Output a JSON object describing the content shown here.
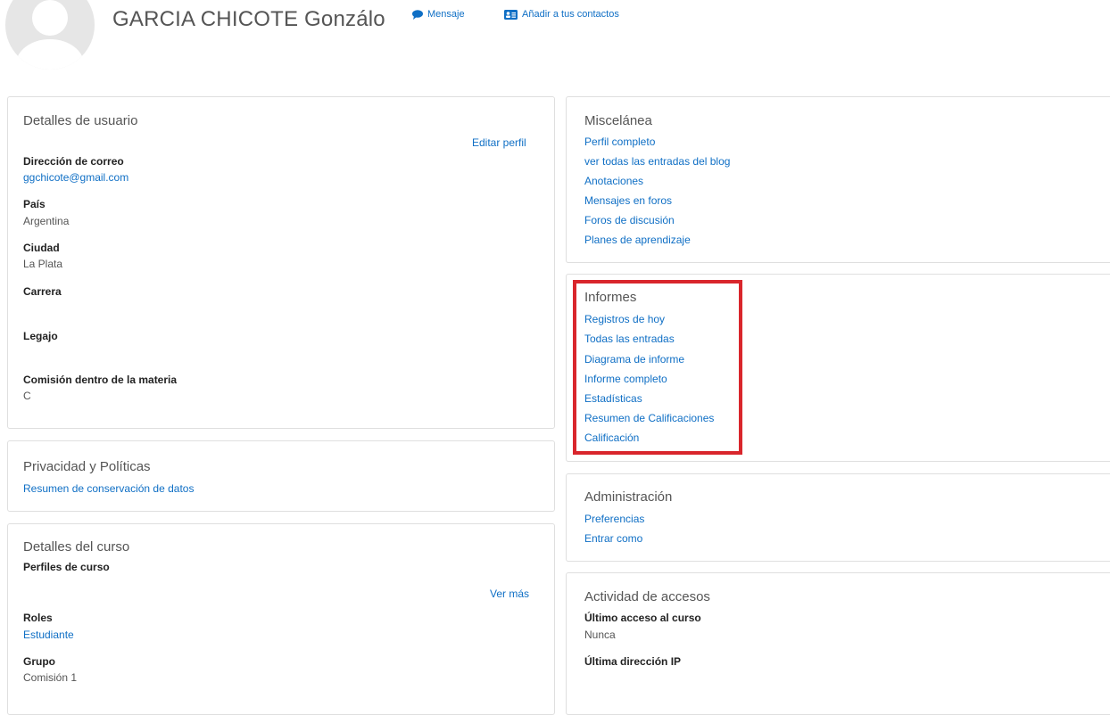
{
  "header": {
    "name": "GARCIA CHICOTE Gonzálo",
    "message_label": "Mensaje",
    "add_contact_label": "Añadir a tus contactos"
  },
  "user_details": {
    "title": "Detalles de usuario",
    "edit_label": "Editar perfil",
    "email_label": "Dirección de correo",
    "email_value": "ggchicote@gmail.com",
    "country_label": "País",
    "country_value": "Argentina",
    "city_label": "Ciudad",
    "city_value": "La Plata",
    "career_label": "Carrera",
    "legajo_label": "Legajo",
    "commission_label": "Comisión dentro de la materia",
    "commission_value": "C"
  },
  "privacy": {
    "title": "Privacidad y Políticas",
    "link": "Resumen de conservación de datos"
  },
  "course_details": {
    "title": "Detalles del curso",
    "profiles_label": "Perfiles de curso",
    "see_more_label": "Ver más",
    "roles_label": "Roles",
    "roles_value": "Estudiante",
    "group_label": "Grupo",
    "group_value": "Comisión 1"
  },
  "misc": {
    "title": "Miscelánea",
    "links": [
      "Perfil completo",
      "ver todas las entradas del blog",
      "Anotaciones",
      "Mensajes en foros",
      "Foros de discusión",
      "Planes de aprendizaje"
    ]
  },
  "reports": {
    "title": "Informes",
    "links": [
      "Registros de hoy",
      "Todas las entradas",
      "Diagrama de informe",
      "Informe completo",
      "Estadísticas",
      "Resumen de Calificaciones",
      "Calificación"
    ]
  },
  "admin": {
    "title": "Administración",
    "links": [
      "Preferencias",
      "Entrar como"
    ]
  },
  "access": {
    "title": "Actividad de accesos",
    "last_course_label": "Último acceso al curso",
    "last_course_value": "Nunca",
    "last_ip_label": "Última dirección IP"
  },
  "colors": {
    "link": "#0f6fc5",
    "highlight": "#d9262c"
  }
}
